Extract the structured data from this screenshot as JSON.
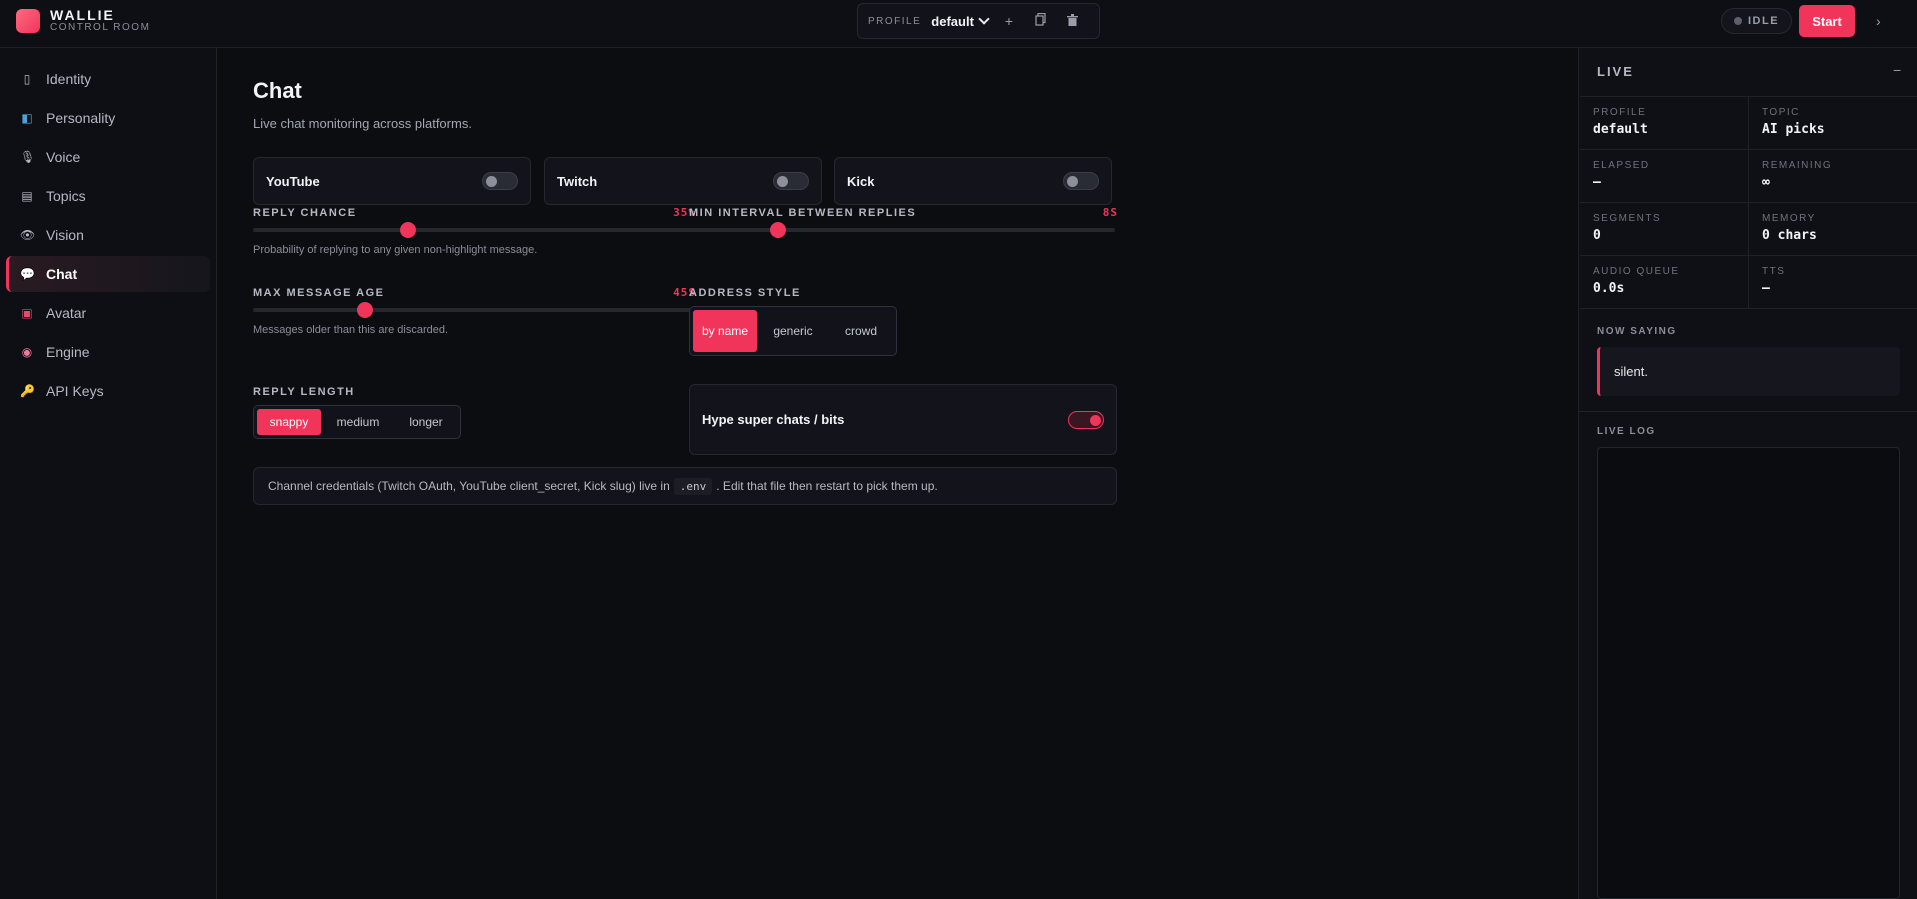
{
  "brand": {
    "name": "WALLIE",
    "subtitle": "CONTROL ROOM"
  },
  "profile_bar": {
    "label": "PROFILE",
    "selected": "default",
    "add_icon": "+",
    "copy_icon": "copy-icon",
    "delete_icon": "trash-icon"
  },
  "status": {
    "label": "IDLE",
    "start_label": "Start",
    "expand_icon": "›"
  },
  "sidebar": {
    "items": [
      {
        "label": "Identity",
        "icon": "▯"
      },
      {
        "label": "Personality",
        "icon": "◧"
      },
      {
        "label": "Voice",
        "icon": "🎙"
      },
      {
        "label": "Topics",
        "icon": "▤"
      },
      {
        "label": "Vision",
        "icon": "👁"
      },
      {
        "label": "Chat",
        "icon": "💬",
        "active": true
      },
      {
        "label": "Avatar",
        "icon": "▣"
      },
      {
        "label": "Engine",
        "icon": "◉"
      },
      {
        "label": "API Keys",
        "icon": "🔑"
      }
    ]
  },
  "page": {
    "title": "Chat",
    "subtitle": "Live chat monitoring across platforms."
  },
  "platforms": [
    {
      "name": "YouTube",
      "enabled": false
    },
    {
      "name": "Twitch",
      "enabled": false
    },
    {
      "name": "Kick",
      "enabled": false
    }
  ],
  "reply_chance": {
    "label": "REPLY CHANCE",
    "value_text": "35%",
    "value": 0.35,
    "hint": "Probability of replying to any given non-highlight message."
  },
  "min_interval": {
    "label": "MIN INTERVAL BETWEEN REPLIES",
    "value_text": "8S",
    "value": 8
  },
  "max_age": {
    "label": "MAX MESSAGE AGE",
    "value_text": "45S",
    "value": 45,
    "hint": "Messages older than this are discarded."
  },
  "address_style": {
    "label": "ADDRESS STYLE",
    "options": [
      "by name",
      "generic",
      "crowd"
    ],
    "selected": "by name"
  },
  "reply_length": {
    "label": "REPLY LENGTH",
    "options": [
      "snappy",
      "medium",
      "longer"
    ],
    "selected": "snappy"
  },
  "hype": {
    "label": "Hype super chats / bits",
    "enabled": true
  },
  "note": {
    "before": "Channel credentials (Twitch OAuth, YouTube client_secret, Kick slug) live in",
    "code": ".env",
    "after": ". Edit that file then restart to pick them up."
  },
  "live": {
    "title": "LIVE",
    "minimize_icon": "−",
    "stats": [
      {
        "label": "PROFILE",
        "value": "default"
      },
      {
        "label": "TOPIC",
        "value": "AI picks"
      },
      {
        "label": "ELAPSED",
        "value": "—"
      },
      {
        "label": "REMAINING",
        "value": "∞"
      },
      {
        "label": "SEGMENTS",
        "value": "0"
      },
      {
        "label": "MEMORY",
        "value": "0 chars"
      },
      {
        "label": "AUDIO QUEUE",
        "value": "0.0s"
      },
      {
        "label": "TTS",
        "value": "—"
      }
    ],
    "now_saying_label": "NOW SAYING",
    "now_saying": "silent.",
    "log_label": "LIVE LOG"
  },
  "colors": {
    "accent": "#f0345a",
    "background": "#0c0d11",
    "panel": "#13141b"
  }
}
